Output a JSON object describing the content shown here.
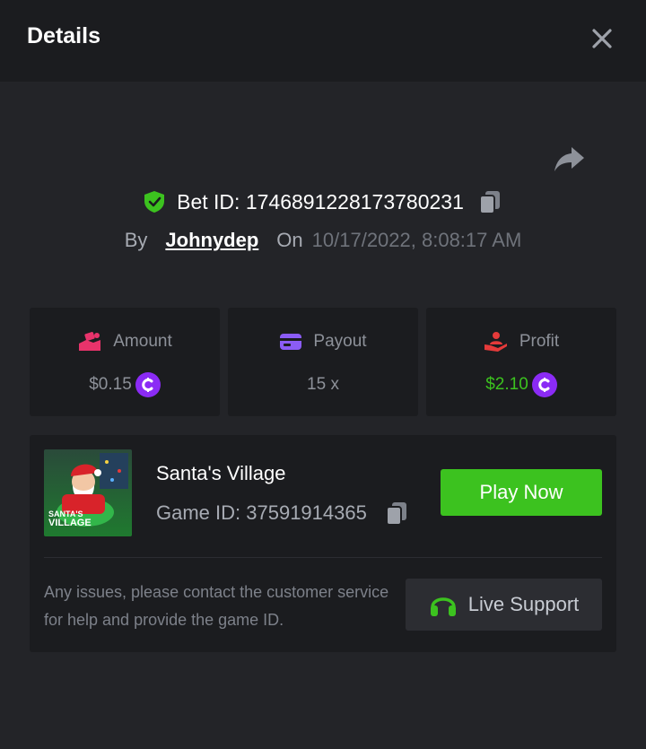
{
  "header": {
    "title": "Details"
  },
  "bet": {
    "id_label": "Bet ID: 1746891228173780231",
    "by_label": "By",
    "username": "Johnydep",
    "on_label": "On",
    "datetime": "10/17/2022, 8:08:17 AM"
  },
  "stats": {
    "amount": {
      "label": "Amount",
      "value": "$0.15",
      "icon": "money-hand-icon",
      "icon_color": "#e8336b"
    },
    "payout": {
      "label": "Payout",
      "value": "15 x",
      "icon": "card-icon",
      "icon_color": "#8b5cf6"
    },
    "profit": {
      "label": "Profit",
      "value": "$2.10",
      "icon": "hand-person-icon",
      "icon_color": "#e53a3a",
      "value_color": "#3cc21f"
    }
  },
  "game": {
    "name": "Santa's Village",
    "id_label": "Game ID: 37591914365",
    "play_label": "Play Now",
    "thumb_text_line1": "SANTA'S",
    "thumb_text_line2": "VILLAGE"
  },
  "support": {
    "message": "Any issues, please contact the customer service for help and provide the game ID.",
    "button_label": "Live Support"
  },
  "colors": {
    "accent_green": "#3cc21f",
    "coin_purple": "#8b2bf5",
    "background": "#232428",
    "card": "#1b1c1f"
  }
}
